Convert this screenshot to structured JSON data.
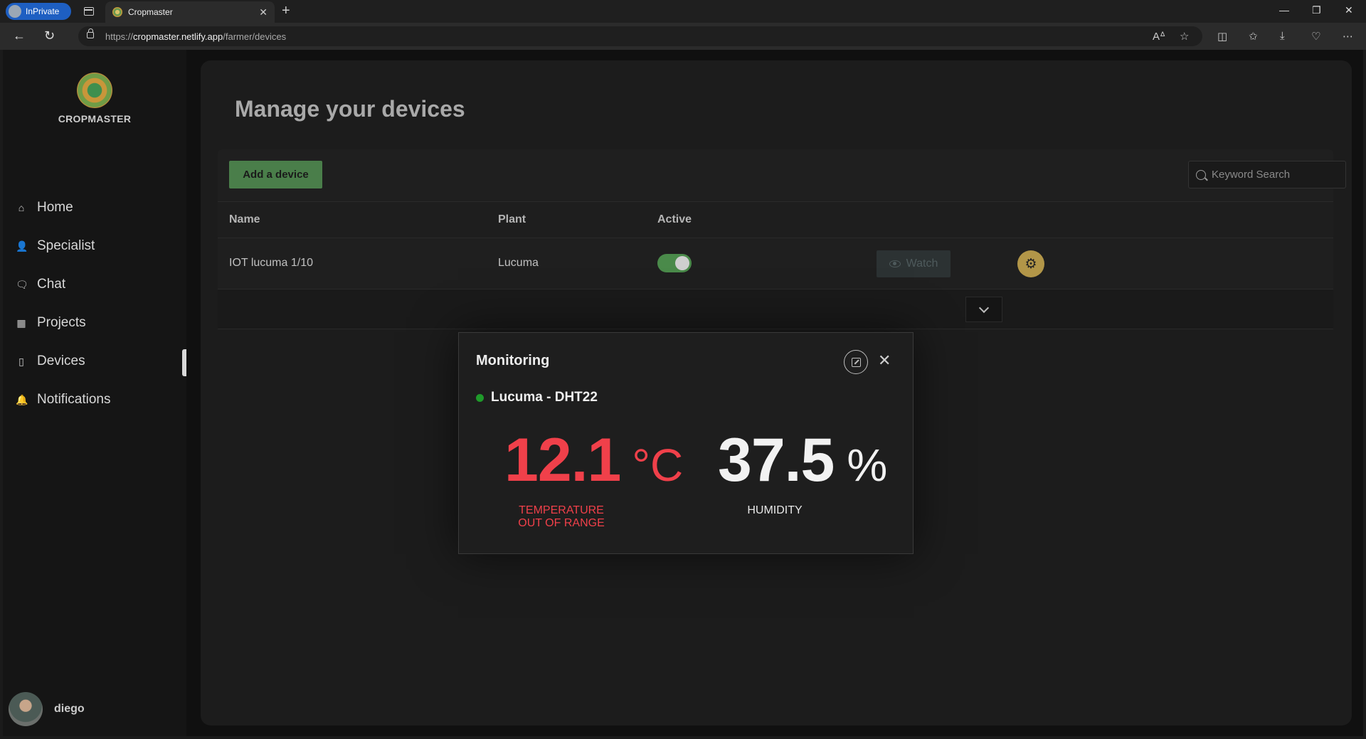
{
  "browser": {
    "inprivate_label": "InPrivate",
    "tab_title": "Cropmaster",
    "url_prefix": "https://",
    "url_host": "cropmaster.netlify.app",
    "url_path": "/farmer/devices"
  },
  "sidebar": {
    "brand": "CROPMASTER",
    "items": [
      {
        "label": "Home",
        "icon": "home-icon",
        "glyph": "⌂"
      },
      {
        "label": "Specialist",
        "icon": "user-icon",
        "glyph": "👤"
      },
      {
        "label": "Chat",
        "icon": "chat-icon",
        "glyph": "🗨"
      },
      {
        "label": "Projects",
        "icon": "calendar-icon",
        "glyph": "▦"
      },
      {
        "label": "Devices",
        "icon": "tablet-icon",
        "glyph": "▯"
      },
      {
        "label": "Notifications",
        "icon": "bell-icon",
        "glyph": "🔔"
      }
    ],
    "active": "Devices",
    "user_name": "diego"
  },
  "main": {
    "title": "Manage your devices",
    "add_button": "Add a device",
    "search_placeholder": "Keyword Search",
    "columns": {
      "name": "Name",
      "plant": "Plant",
      "active": "Active"
    },
    "rows": [
      {
        "name": "IOT lucuma 1/10",
        "plant": "Lucuma",
        "active": true,
        "watch_label": "Watch"
      }
    ]
  },
  "modal": {
    "title": "Monitoring",
    "device": "Lucuma - DHT22",
    "temperature": "12.1",
    "temperature_unit": "°C",
    "temperature_label_1": "TEMPERATURE",
    "temperature_label_2": "OUT OF RANGE",
    "humidity": "37.5",
    "humidity_unit": "%",
    "humidity_label": "HUMIDITY"
  },
  "colors": {
    "accent_green": "#4a7e4a",
    "alert_red": "#f0404a",
    "gear_gold": "#b29648",
    "status_dot": "#1f9a2a"
  }
}
